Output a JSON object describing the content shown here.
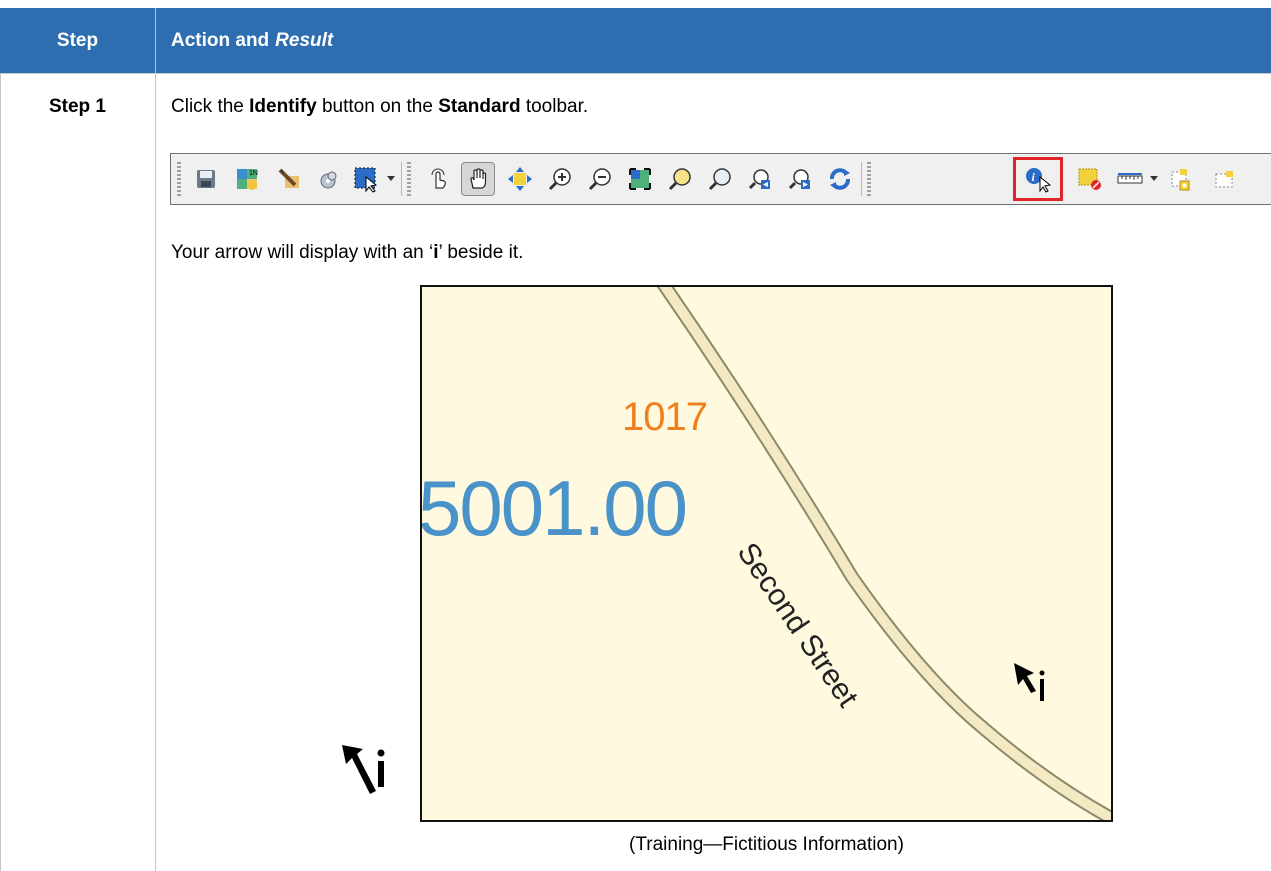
{
  "header": {
    "step_col": "Step",
    "action_col": "Action and",
    "result_col": "Result"
  },
  "row": {
    "step_label": "Step 1",
    "instruction": {
      "pre": "Click the ",
      "bold1": "Identify",
      "mid": " button on the ",
      "bold2": "Standard",
      "post": " toolbar."
    },
    "sentence2": {
      "pre": "Your arrow will display with an ‘",
      "bold": "i",
      "post": "’ beside it."
    },
    "map": {
      "block_label": "1017",
      "tract_label": "5001.00",
      "street_label": "Second Street",
      "cursor_glyph": "i"
    },
    "caption": "(Training—Fictitious Information)"
  },
  "toolbar": {
    "buttons": [
      {
        "name": "save-project-icon"
      },
      {
        "name": "new-map-icon"
      },
      {
        "name": "edit-pencil-icon"
      },
      {
        "name": "refresh-cd-icon"
      },
      {
        "name": "select-features-icon"
      },
      {
        "name": "touch-pan-icon"
      },
      {
        "name": "pan-hand-icon"
      },
      {
        "name": "pan-to-selection-icon"
      },
      {
        "name": "zoom-in-icon"
      },
      {
        "name": "zoom-out-icon"
      },
      {
        "name": "zoom-full-icon"
      },
      {
        "name": "zoom-to-selection-icon"
      },
      {
        "name": "zoom-to-layer-icon"
      },
      {
        "name": "zoom-last-icon"
      },
      {
        "name": "zoom-next-icon"
      },
      {
        "name": "refresh-icon"
      },
      {
        "name": "identify-icon"
      },
      {
        "name": "deselect-icon"
      },
      {
        "name": "measure-icon"
      },
      {
        "name": "add-feature-icon"
      },
      {
        "name": "new-layer-icon"
      }
    ]
  },
  "colors": {
    "header_bg": "#2e6eb0",
    "map_bg": "#fff9e0",
    "tract_label": "#4a93c8",
    "block_label": "#f07f1e",
    "highlight": "#e0262b"
  }
}
